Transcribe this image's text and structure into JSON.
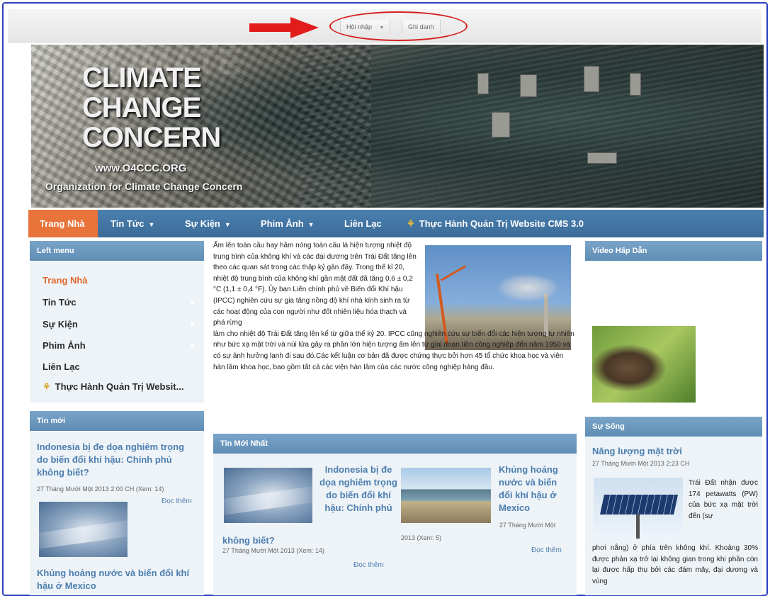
{
  "topbar": {
    "login_label": "Hội nhập",
    "register_label": "Ghi danh"
  },
  "banner": {
    "title_line1": "CLIMATE",
    "title_line2": "CHANGE",
    "title_line3": "CONCERN",
    "ghost_text": "CLIMATE",
    "site_url": "www.O4CCC.ORG",
    "org_name": "Organization for Climate Change Concern"
  },
  "nav": {
    "items": [
      {
        "label": "Trang Nhà",
        "dropdown": false
      },
      {
        "label": "Tin Tức",
        "dropdown": true
      },
      {
        "label": "Sự Kiện",
        "dropdown": true
      },
      {
        "label": "Phim Ảnh",
        "dropdown": true
      },
      {
        "label": "Liên Lạc",
        "dropdown": false
      },
      {
        "label": "Thực Hành Quản Trị Website CMS 3.0",
        "dropdown": false
      }
    ]
  },
  "left_menu": {
    "title": "Left menu",
    "items": [
      "Trang Nhà",
      "Tin Tức",
      "Sự Kiện",
      "Phim Ảnh",
      "Liên Lạc",
      "Thực Hành Quản Trị Websit..."
    ]
  },
  "tin_moi": {
    "title": "Tin mới",
    "item1_title": "Indonesia bị đe dọa nghiêm trọng do biến đổi khí hậu: Chính phủ không biết?",
    "item1_meta": "27 Tháng Mười Một 2013 2:00 CH (Xem: 14)",
    "item1_more": "Đọc thêm",
    "item2_title": "Khủng hoảng nước và biến đổi khí hậu ở Mexico"
  },
  "article": {
    "text_top": "Ấm lên toàn cầu hay hâm nóng toàn cầu là hiện tượng nhiệt độ trung bình của không khí và các đại dương trên Trái Đất tăng lên theo các quan sát trong các thập kỷ gần đây. Trong thế kỉ 20, nhiệt độ trung bình của không khí gần mặt đất đã tăng 0,6 ± 0,2 °C (1,1 ± 0,4 °F). Ủy ban Liên chính phủ về Biến đổi Khí hậu (IPCC) nghiên cứu sự gia tăng nồng độ khí nhà kính sinh ra từ các hoạt động của con người như đốt nhiên liệu hóa thạch và phá rừng",
    "text_bottom": "làm cho nhiệt độ Trái Đất tăng lên kể từ giữa thế kỷ 20. IPCC cũng nghiên cứu sự biến đổi các hiện tượng tự nhiên như bức xạ mặt trời và núi lửa gây ra phần lớn hiện tượng ấm lên từ giai đoạn tiền công nghiệp đến năm 1950 và có sự ảnh hưởng lạnh đi sau đó.Các kết luận cơ bản đã được chứng thực bởi hơn 45 tổ chức khoa học và viện hàn lâm khoa học, bao gồm tất cả các viện hàn lâm của các nước công nghiệp hàng đầu."
  },
  "tin_moi_nhat": {
    "title": "Tin Mới Nhất",
    "card1_title_a": "Indonesia bị đe dọa nghiêm trọng do biến đổi khí hậu: Chính phủ",
    "card1_title_b": "không biết?",
    "card1_meta": "27 Tháng Mười Một 2013 (Xem: 14)",
    "card1_more": "Đọc thêm",
    "card2_title": "Khủng hoảng nước và biến đổi khí hậu ở Mexico",
    "card2_meta_a": "27 Tháng Mười Một",
    "card2_meta_b": "2013 (Xem: 5)",
    "card2_more": "Đọc thêm"
  },
  "video": {
    "title": "Video Hấp Dẫn"
  },
  "su_song": {
    "title": "Sự Sống",
    "item_title": "Năng lượng mặt trời",
    "item_meta": "27 Tháng Mười Một 2013 2:23 CH",
    "text_side": "Trái Đất nhận được 174 petawatts (PW) của bức xạ mặt trời đến (sự",
    "text_full": "phơi nắng) ở phía trên không khí. Khoảng 30% được phản xạ trở lại không gian trong khi phần còn lại được hấp thụ bởi các đám mây, đại dương và vùng"
  }
}
